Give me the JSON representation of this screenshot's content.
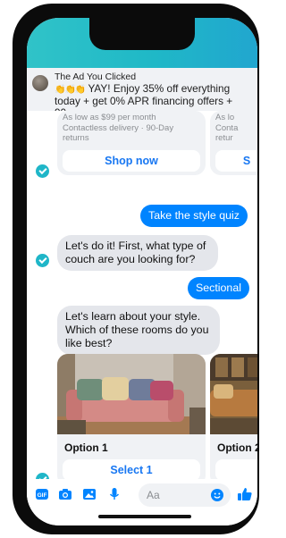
{
  "header": {
    "ad_label": "The Ad You Clicked",
    "ad_text_emoji": "👏👏👏",
    "ad_text": "YAY! Enjoy 35% off everything today + get 0% APR financing offers + 90-..."
  },
  "products": [
    {
      "price": "As low as $99 per month",
      "details": "Contactless delivery · 90-Day returns",
      "button": "Shop now"
    },
    {
      "price": "As lo",
      "details": "Conta",
      "extra": "retur",
      "button": "S"
    }
  ],
  "messages": {
    "quiz": "Take the style quiz",
    "couch_question": "Let's do it! First, what type of couch are you looking for?",
    "sectional": "Sectional",
    "rooms_question": "Let's learn about your style. Which of these rooms do you like best?"
  },
  "options": [
    {
      "label": "Option 1",
      "button": "Select 1"
    },
    {
      "label": "Option 2",
      "button": ""
    }
  ],
  "composer": {
    "placeholder": "Aa",
    "gif_label": "GIF"
  },
  "colors": {
    "accent": "#0084ff",
    "link": "#1877f2",
    "brand_teal": "#1fb6c8"
  }
}
